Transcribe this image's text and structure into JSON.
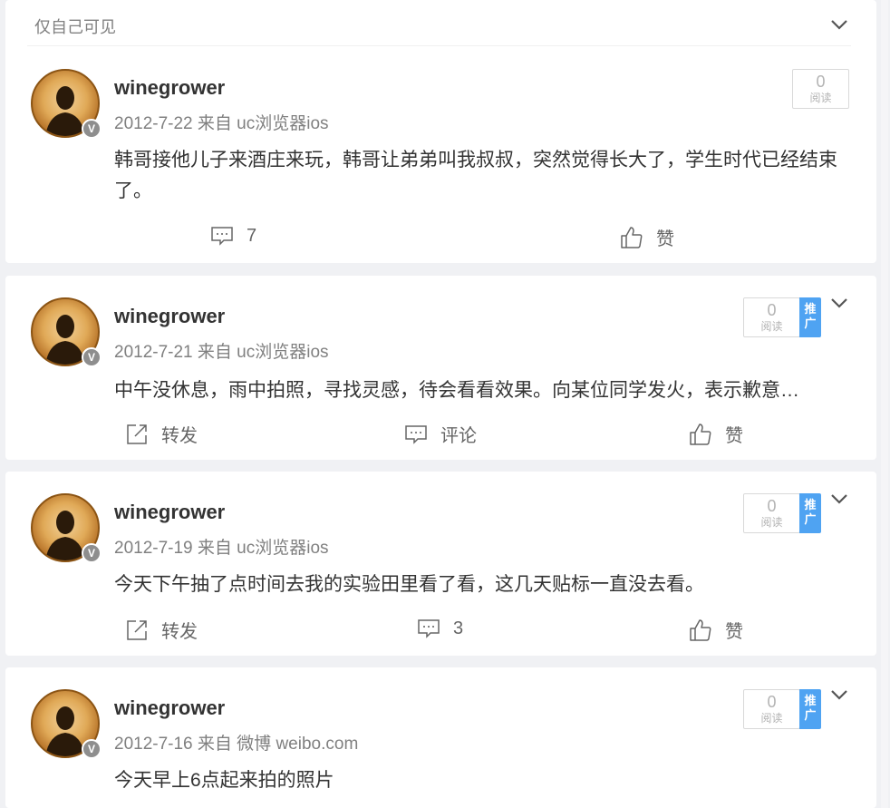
{
  "visibility": {
    "label": "仅自己可见"
  },
  "posts": [
    {
      "username": "winegrower",
      "date": "2012-7-22",
      "source": "来自 uc浏览器ios",
      "content": "韩哥接他儿子来酒庄来玩，韩哥让弟弟叫我叔叔，突然觉得长大了，学生时代已经结束了。",
      "read_count": "0",
      "read_label": "阅读",
      "comment_count": "7",
      "like_label": "赞",
      "verified_badge": "V"
    },
    {
      "username": "winegrower",
      "date": "2012-7-21",
      "source": "来自 uc浏览器ios",
      "content": "中午没休息，雨中拍照，寻找灵感，待会看看效果。向某位同学发火，表示歉意…",
      "read_count": "0",
      "read_label": "阅读",
      "promo_label": "推广",
      "repost_label": "转发",
      "comment_label": "评论",
      "like_label": "赞",
      "verified_badge": "V"
    },
    {
      "username": "winegrower",
      "date": "2012-7-19",
      "source": "来自 uc浏览器ios",
      "content": "今天下午抽了点时间去我的实验田里看了看，这几天贴标一直没去看。",
      "read_count": "0",
      "read_label": "阅读",
      "promo_label": "推广",
      "repost_label": "转发",
      "comment_count": "3",
      "like_label": "赞",
      "verified_badge": "V"
    },
    {
      "username": "winegrower",
      "date": "2012-7-16",
      "source": "来自 微博 weibo.com",
      "content": "今天早上6点起来拍的照片",
      "read_count": "0",
      "read_label": "阅读",
      "promo_label": "推广",
      "verified_badge": "V"
    }
  ],
  "icons": {
    "chevron": "chevron-down-icon",
    "comment": "comment-icon",
    "like": "thumbs-up-icon",
    "repost": "repost-icon"
  },
  "colors": {
    "background": "#f0f1f4",
    "promo": "#4fa3f2",
    "text_secondary": "#808080"
  }
}
